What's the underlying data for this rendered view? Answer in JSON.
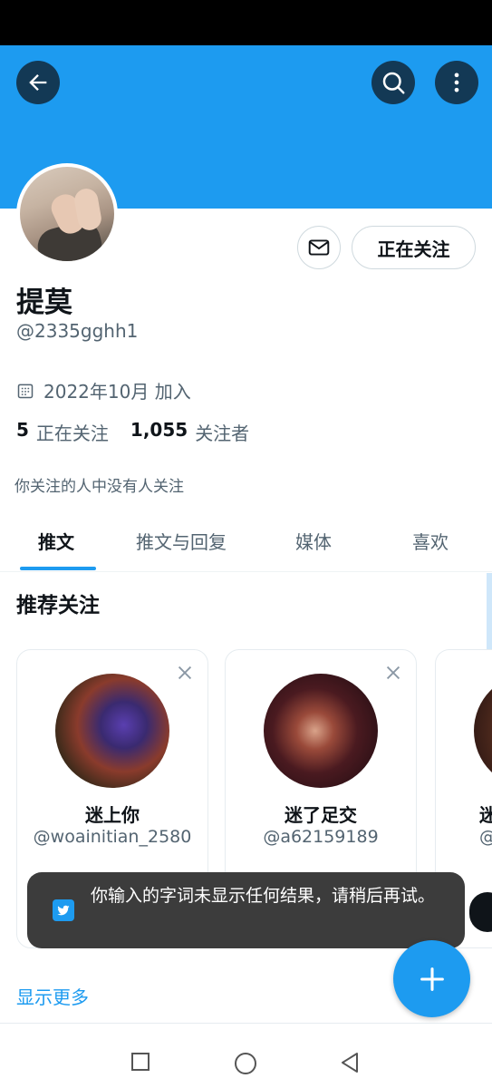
{
  "colors": {
    "accent": "#1d9bf0",
    "text": "#0f1419",
    "muted": "#536471"
  },
  "header": {
    "back_icon": "arrow-left-icon",
    "search_icon": "search-icon",
    "more_icon": "more-vertical-icon"
  },
  "profile": {
    "display_name": "提莫",
    "handle": "@2335gghh1",
    "joined": "2022年10月 加入",
    "following_count": "5",
    "following_label": "正在关注",
    "followers_count": "1,055",
    "followers_label": "关注者",
    "mutual_note": "你关注的人中没有人关注",
    "follow_button": "正在关注"
  },
  "tabs": [
    {
      "label": "推文",
      "active": true
    },
    {
      "label": "推文与回复",
      "active": false
    },
    {
      "label": "媒体",
      "active": false
    },
    {
      "label": "喜欢",
      "active": false
    }
  ],
  "recommendations": {
    "title": "推荐关注",
    "cards": [
      {
        "name": "迷上你",
        "handle": "@woainitian_2580"
      },
      {
        "name": "迷了足交",
        "handle": "@a62159189"
      },
      {
        "name": "迷",
        "handle": "@"
      }
    ],
    "show_more": "显示更多"
  },
  "toast": {
    "message": "你输入的字词未显示任何结果，请稍后再试。"
  },
  "fab_icon": "plus-icon",
  "nav": {
    "recent_icon": "square-icon",
    "home_icon": "circle-icon",
    "back_icon": "triangle-back-icon"
  }
}
